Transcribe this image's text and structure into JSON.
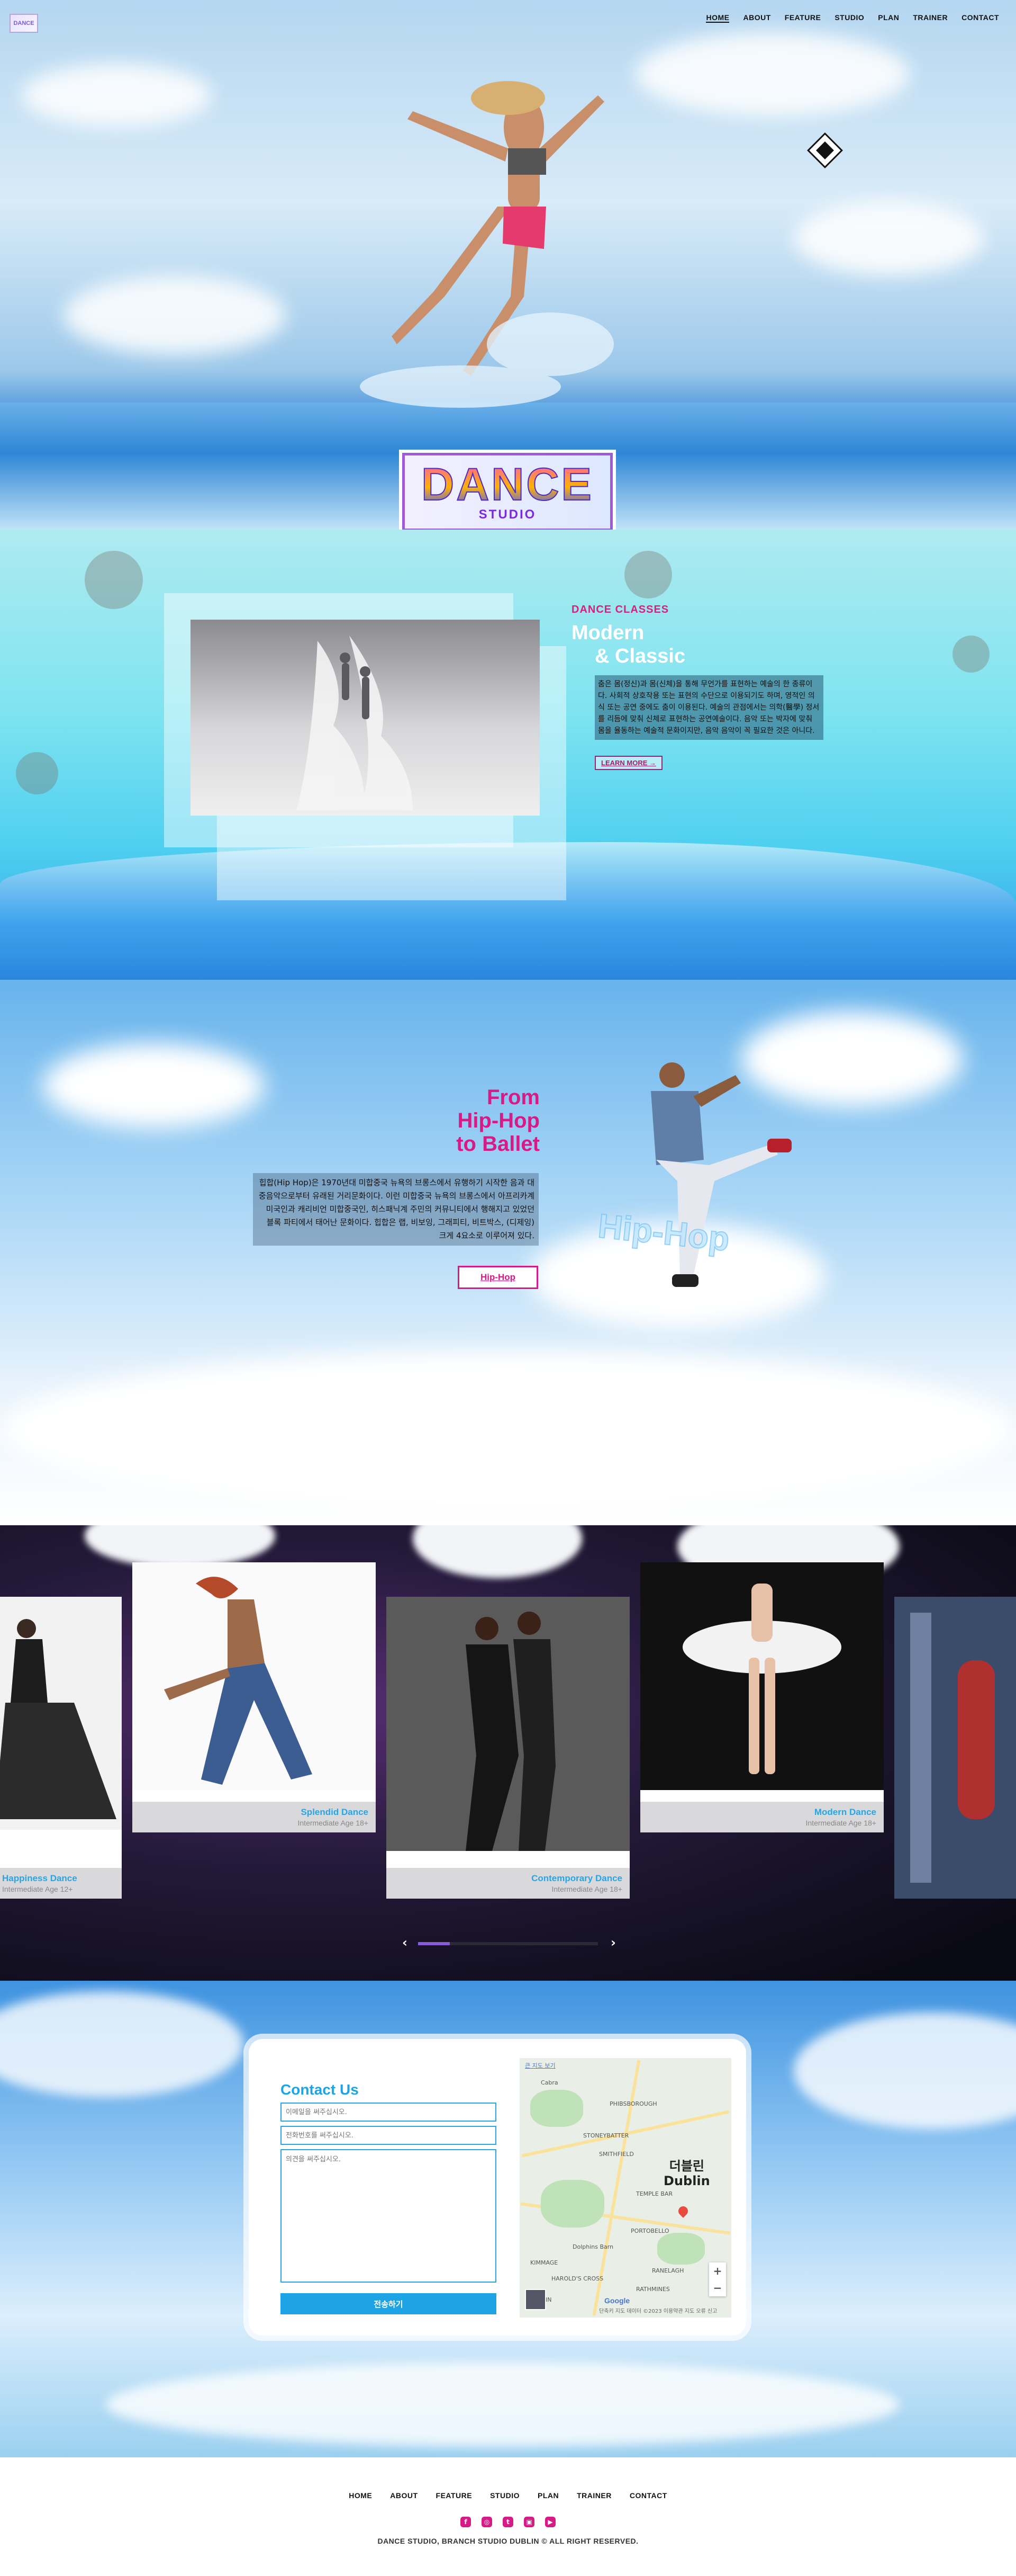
{
  "header": {
    "logo_text": "DANCE",
    "nav": [
      "HOME",
      "ABOUT",
      "FEATURE",
      "STUDIO",
      "PLAN",
      "TRAINER",
      "CONTACT"
    ],
    "active_nav": "HOME"
  },
  "brand": {
    "logo_big": "DANCE",
    "logo_small": "STUDIO"
  },
  "classes": {
    "eyebrow": "DANCE CLASSES",
    "title_line1": "Modern",
    "title_line2": "& Classic",
    "body": "춤은 몸(정신)과 몸(신체)을 통해 무언가를 표현하는 예술의 한 종류이다. 사회적 상호작용 또는 표현의 수단으로 이용되기도 하며, 영적인 의식 또는 공연 중에도 춤이 이용된다. 예술의 관점에서는 의학(醫學) 정서를 리듬에 맞춰 신체로 표현하는 공연예술이다. 음악 또는 박자에 맞춰 몸을 율동하는 예술적 문화이지만, 음악 음악이 꼭 필요한 것은 아니다.",
    "learn_more": "LEARN MORE"
  },
  "hiphop": {
    "title_line1": "From",
    "title_line2": "Hip-Hop",
    "title_line3": "to Ballet",
    "body": "힙합(Hip Hop)은 1970년대 미합중국 뉴욕의 브롱스에서 유행하기 시작한 음과 대중음악으로부터 유래된 거리문화이다. 이런 미합중국 뉴욕의 브롱스에서 아프리카계 미국인과 캐리비언 미합중국인, 히스패닉계 주민의 커뮤니티에서 행해지고 있었던 블록 파티에서 태어난 문화이다. 힙합은 랩, 비보잉, 그래피티, 비트박스, (디제잉) 크게 4요소로 이루어져 있다.",
    "button": "Hip-Hop",
    "ghost_text": "Hip-Hop"
  },
  "gallery": {
    "cards": [
      {
        "title": "Happiness Dance",
        "subtitle": "Intermediate Age 12+"
      },
      {
        "title": "Splendid Dance",
        "subtitle": "Intermediate Age 18+"
      },
      {
        "title": "Contemporary Dance",
        "subtitle": "Intermediate Age 18+"
      },
      {
        "title": "Modern Dance",
        "subtitle": "Intermediate Age 18+"
      }
    ],
    "prev": "‹",
    "next": "›"
  },
  "contact": {
    "title": "Contact Us",
    "name_placeholder": "이메일을 써주십시오.",
    "phone_placeholder": "전화번호를 써주십시오.",
    "message_placeholder": "의견을 써주십시오.",
    "submit": "전송하기",
    "map": {
      "top_link": "큰 지도 보기",
      "city_ko": "더블린",
      "city_en": "Dublin",
      "labels": [
        "Cabra",
        "PHIBSBOROUGH",
        "STONEYBATTER",
        "SMITHFIELD",
        "TEMPLE BAR",
        "PORTOBELLO",
        "RANELAGH",
        "HAROLD'S CROSS",
        "RATHMINES",
        "KIMMAGE",
        "Dolphins Barn",
        "CRUMLIN"
      ],
      "google": "Google",
      "footer": "단축키   지도 데이터 ©2023   이용약관   지도 오류 신고"
    }
  },
  "footer": {
    "nav": [
      "HOME",
      "ABOUT",
      "FEATURE",
      "STUDIO",
      "PLAN",
      "TRAINER",
      "CONTACT"
    ],
    "social": [
      "f",
      "◎",
      "t",
      "▣",
      "▶"
    ],
    "copyright": "DANCE STUDIO, BRANCH STUDIO DUBLIN © ALL RIGHT RESERVED."
  },
  "colors": {
    "accent_pink": "#d61a86",
    "accent_blue": "#1ea3e4",
    "logo_purple": "#a05ad8"
  }
}
